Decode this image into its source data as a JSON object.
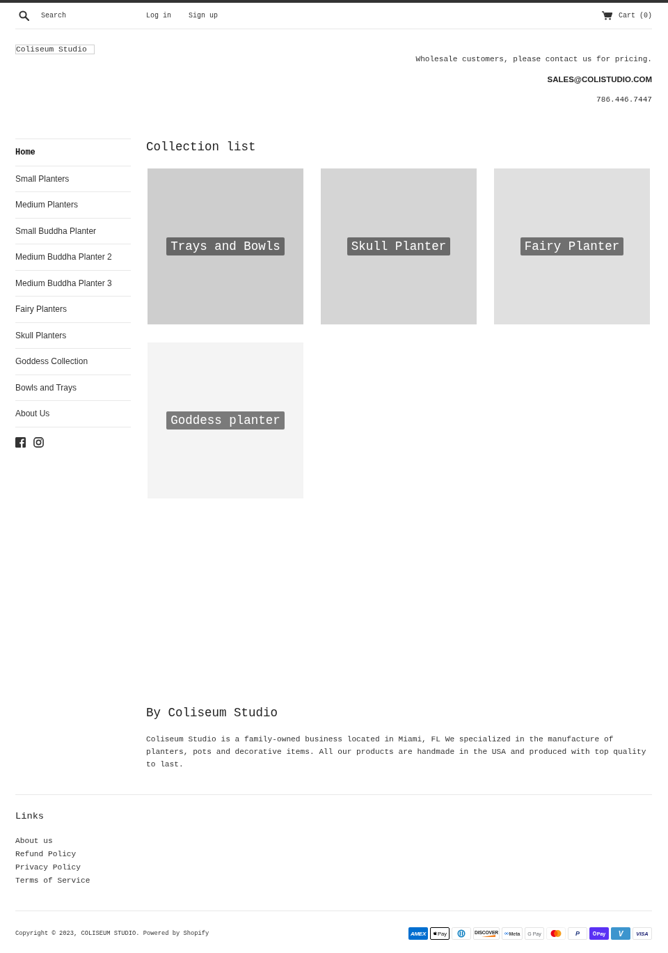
{
  "header": {
    "search": {
      "placeholder": "Search"
    },
    "account_links": [
      "Log in",
      "Sign up"
    ],
    "cart": "Cart (0)"
  },
  "logo": "Coliseum Studio",
  "contact": {
    "note": "Wholesale customers, please contact us for pricing.",
    "email": "SALES@COLISTUDIO.COM",
    "phone": "786.446.7447"
  },
  "sidebar": {
    "items": [
      {
        "label": "Home",
        "selected": true
      },
      {
        "label": "Small Planters",
        "selected": false
      },
      {
        "label": "Medium Planters",
        "selected": false
      },
      {
        "label": "Small Buddha Planter",
        "selected": false
      },
      {
        "label": "Medium Buddha Planter 2",
        "selected": false
      },
      {
        "label": "Medium Buddha Planter 3",
        "selected": false
      },
      {
        "label": "Fairy Planters",
        "selected": false
      },
      {
        "label": "Skull Planters",
        "selected": false
      },
      {
        "label": "Goddess Collection",
        "selected": false
      },
      {
        "label": "Bowls and Trays",
        "selected": false
      },
      {
        "label": "About Us",
        "selected": false
      }
    ],
    "social": [
      {
        "kind": "facebook"
      },
      {
        "kind": "instagram"
      }
    ]
  },
  "collections": {
    "title": "Collection list",
    "items": [
      {
        "title": "Trays and Bowls",
        "color": "#cecece"
      },
      {
        "title": "Skull Planter",
        "color": "#d5d5d5"
      },
      {
        "title": "Fairy Planter",
        "color": "#e0e0e0"
      },
      {
        "title": "Goddess planter",
        "color": "#f4f4f4"
      }
    ]
  },
  "about": {
    "title": "By Coliseum Studio",
    "text": "Coliseum Studio is a family-owned business located in Miami, FL We specialized in the manufacture of planters, pots and decorative items. All our products are handmade in the USA and produced with top quality to last."
  },
  "footer": {
    "title": "Links",
    "links": [
      "About us",
      "Refund Policy",
      "Privacy Policy",
      "Terms of Service"
    ],
    "copyright": "Copyright © 2023, COLISEUM STUDIO. Powered by Shopify",
    "payments": [
      {
        "kind": "amex",
        "label": "AMEX"
      },
      {
        "kind": "apple_pay",
        "label": "Pay"
      },
      {
        "kind": "diners"
      },
      {
        "kind": "discover",
        "label": "DISCOVER"
      },
      {
        "kind": "meta_pay",
        "label": "Meta"
      },
      {
        "kind": "google_pay",
        "label": "G Pay"
      },
      {
        "kind": "mastercard"
      },
      {
        "kind": "paypal",
        "label": "P"
      },
      {
        "kind": "shop_pay",
        "label": "Pay"
      },
      {
        "kind": "venmo",
        "label": "V"
      },
      {
        "kind": "visa",
        "label": "VISA"
      }
    ]
  }
}
